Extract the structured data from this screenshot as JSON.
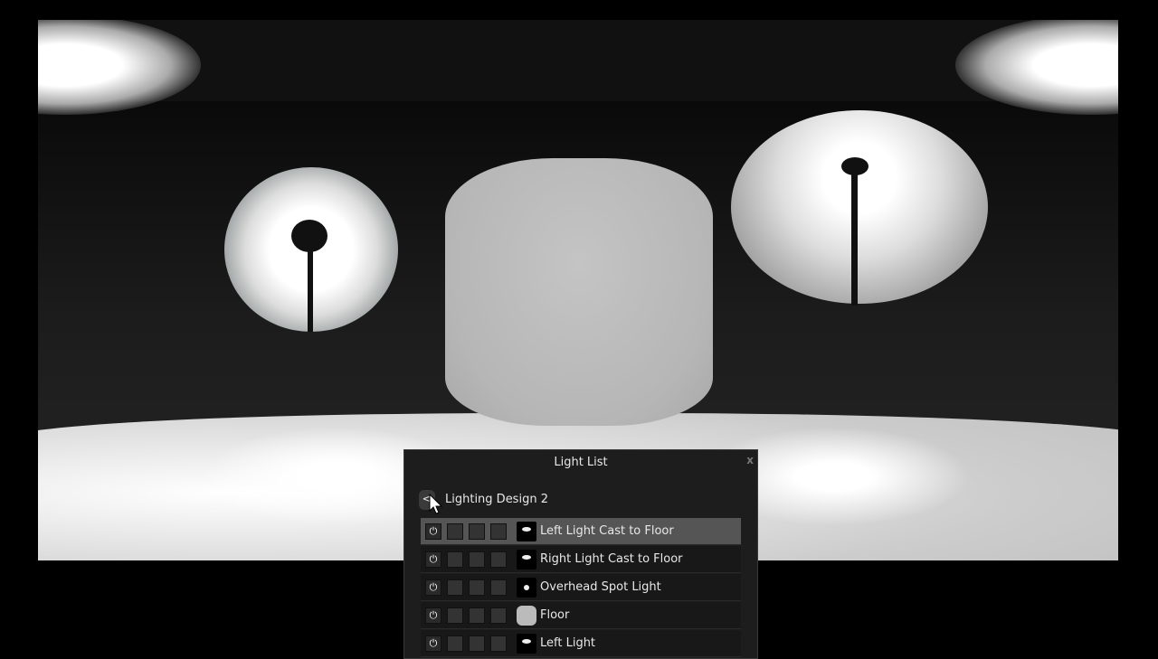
{
  "panel": {
    "title": "Light List",
    "close_label": "x",
    "back_label": "<",
    "design_name": "Lighting Design 2",
    "items": [
      {
        "label": "Left Light Cast to Floor",
        "selected": true,
        "thumb": "cast"
      },
      {
        "label": "Right Light Cast to Floor",
        "selected": false,
        "thumb": "cast"
      },
      {
        "label": "Overhead Spot Light",
        "selected": false,
        "thumb": "spot"
      },
      {
        "label": "Floor",
        "selected": false,
        "thumb": "floor"
      },
      {
        "label": "Left Light",
        "selected": false,
        "thumb": "light"
      }
    ]
  },
  "icons": [
    "power-icon",
    "solo-icon",
    "select-icon",
    "lock-icon",
    "cursor-icon"
  ]
}
